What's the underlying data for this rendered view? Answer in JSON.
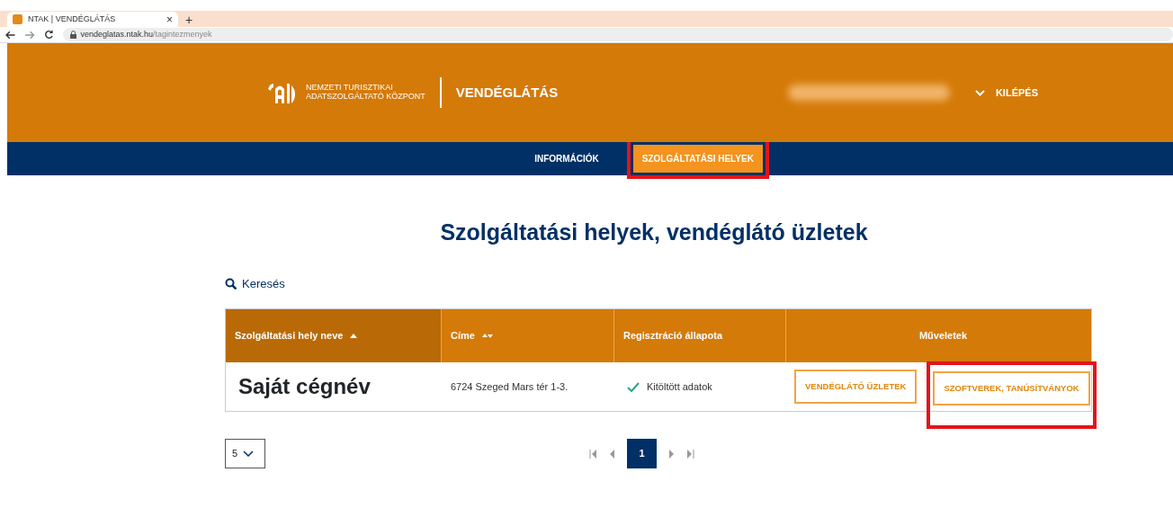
{
  "browser": {
    "tab": {
      "title": "NTAK | VENDÉGLÁTÁS",
      "close": "×"
    },
    "new_tab": "+",
    "url": {
      "host": "vendeglatas.ntak.hu",
      "path": "/tagintezmenyek"
    }
  },
  "header": {
    "org_name": [
      "NEMZETI TURISZTIKAI",
      "ADATSZOLGÁLTATÓ KÖZPONT"
    ],
    "section": "VENDÉGLÁTÁS",
    "logout": "KILÉPÉS"
  },
  "nav": [
    {
      "label": "INFORMÁCIÓK",
      "selected": false,
      "highlighted": false
    },
    {
      "label": "SZOLGÁLTATÁSI HELYEK",
      "selected": true,
      "highlighted": true
    }
  ],
  "title": "Szolgáltatási helyek, vendéglátó üzletek",
  "search": "Keresés",
  "table": {
    "columns": [
      {
        "label": "Szolgáltatási hely neve",
        "kind": "ascending",
        "sorted": true
      },
      {
        "label": "Címe",
        "kind": "sortable",
        "sorted": false
      },
      {
        "label": "Regisztráció állapota",
        "kind": "plain",
        "sorted": false
      },
      {
        "label": "Műveletek",
        "kind": "plain",
        "sorted": false
      }
    ],
    "rows": [
      {
        "name": "Saját cégnév",
        "address": "6724 Szeged Mars tér 1-3.",
        "status": {
          "text": "Kitöltött adatok",
          "done": true
        },
        "actions": [
          {
            "label": "VENDÉGLÁTÓ ÜZLETEK",
            "highlighted": false
          },
          {
            "label": "SZOFTVEREK, TANÚSÍTVÁNYOK",
            "highlighted": true
          }
        ]
      }
    ]
  },
  "page_size": "5",
  "pages": [
    {
      "label": "1",
      "selected": true
    }
  ]
}
